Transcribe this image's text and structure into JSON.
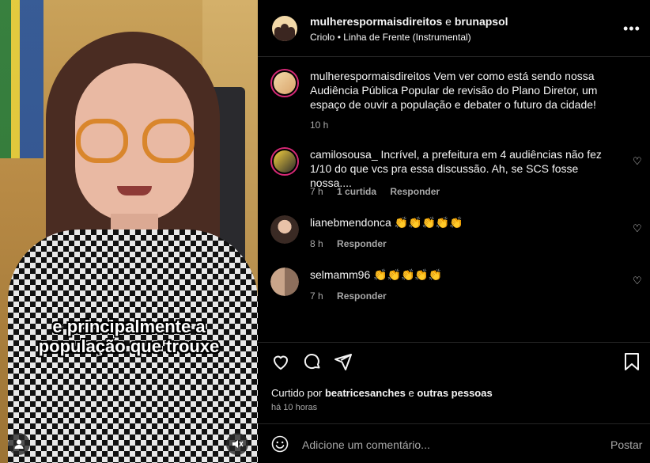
{
  "video": {
    "caption_line1": "e principalmente a",
    "caption_line2": "população que trouxe",
    "user_icon": "user-icon",
    "mute_icon": "muted-speaker-icon"
  },
  "header": {
    "author1": "mulherespormaisdireitos",
    "joiner": "e",
    "author2": "brunapsol",
    "artist": "Criolo",
    "separator": "•",
    "track": "Linha de Frente (Instrumental)",
    "more_icon": "more-horizontal-icon"
  },
  "comments": [
    {
      "user": "mulherespormaisdireitos",
      "text": "Vem ver como está sendo nossa Audiência Pública Popular de revisão do Plano Diretor, um espaço de ouvir a população e debater o futuro da cidade!",
      "time": "10 h"
    },
    {
      "user": "camilosousa_",
      "text": "Incrível, a prefeitura em 4 audiências não fez 1/10 do que vcs pra essa discussão. Ah, se SCS fosse nossa....",
      "time": "7 h",
      "likes": "1 curtida",
      "reply": "Responder"
    },
    {
      "user": "lianebmendonca",
      "text": "👏👏👏👏👏",
      "time": "8 h",
      "reply": "Responder"
    },
    {
      "user": "selmamm96",
      "text": "👏👏👏👏👏",
      "time": "7 h",
      "reply": "Responder"
    }
  ],
  "actions": {
    "liked_by_prefix": "Curtido por",
    "liked_by_user": "beatricesanches",
    "liked_by_joiner": "e",
    "liked_by_others": "outras pessoas",
    "posted_ago": "há 10 horas"
  },
  "add_comment": {
    "placeholder": "Adicione um comentário...",
    "post_label": "Postar"
  },
  "colors": {
    "background": "#000000",
    "text": "#f5f5f5",
    "muted": "#a8a8a8",
    "story_ring": "#d62976"
  }
}
